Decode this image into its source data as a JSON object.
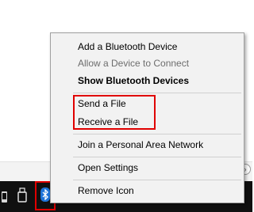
{
  "context_menu": {
    "items": [
      {
        "label": "Add a Bluetooth Device",
        "state": "enabled"
      },
      {
        "label": "Allow a Device to Connect",
        "state": "disabled"
      },
      {
        "label": "Show Bluetooth Devices",
        "state": "default"
      },
      {
        "label": "Send a File",
        "state": "enabled"
      },
      {
        "label": "Receive a File",
        "state": "enabled"
      },
      {
        "label": "Join a Personal Area Network",
        "state": "enabled"
      },
      {
        "label": "Open Settings",
        "state": "enabled"
      },
      {
        "label": "Remove Icon",
        "state": "enabled"
      }
    ]
  },
  "taskbar": {
    "tray_icons": [
      "phone-icon",
      "usb-drive-icon",
      "bluetooth-icon"
    ]
  },
  "colors": {
    "menu_bg": "#f2f2f2",
    "highlight_red": "#e00000",
    "taskbar_bg": "#101010",
    "bluetooth_blue": "#1e73d8"
  }
}
